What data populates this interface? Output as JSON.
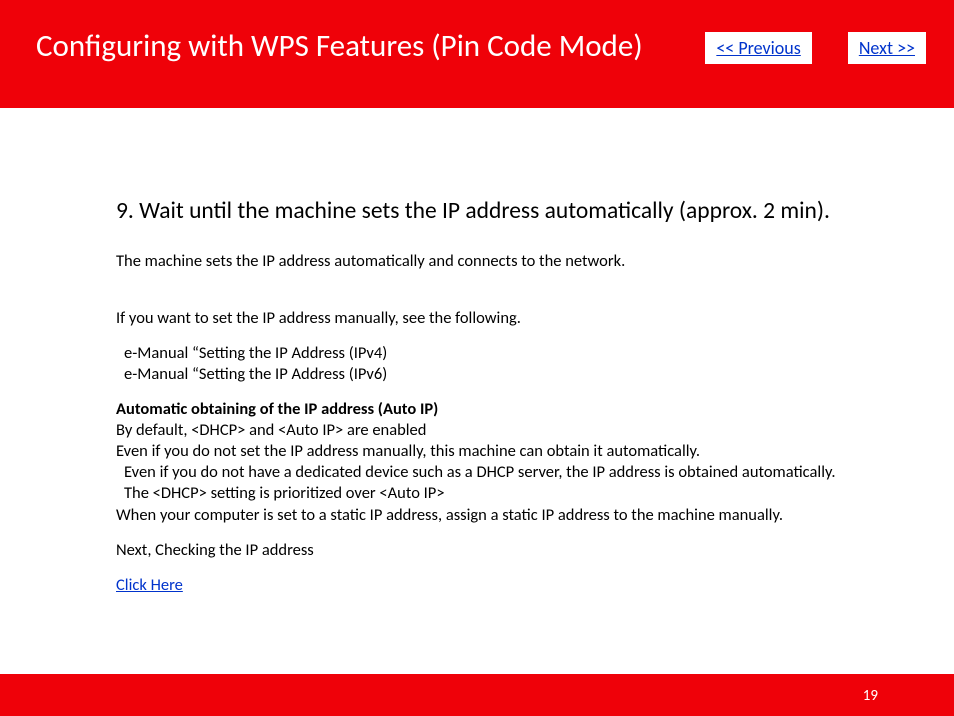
{
  "header": {
    "title": "Configuring with WPS Features (Pin Code Mode)",
    "previous_label": "<< Previous",
    "next_label": "Next >>"
  },
  "content": {
    "step_heading": "9. Wait until the machine sets the IP address automatically (approx. 2 min).",
    "intro": "The machine sets the IP address automatically and connects to the network.",
    "manual_note": "If you want to set the IP address manually, see the following.",
    "manual_ref_ipv4": "e-Manual “Setting the IP Address (IPv4)",
    "manual_ref_ipv6": "e-Manual “Setting the IP Address (IPv6)",
    "auto_ip_heading": "Automatic obtaining of the IP address (Auto IP)",
    "auto_ip_line1": "By default, <DHCP> and <Auto IP> are enabled",
    "auto_ip_line2": "Even if you do not set the IP address manually, this machine can obtain it automatically.",
    "auto_ip_line3": "Even if you do not have a dedicated device such as a DHCP server, the IP address is obtained automatically.",
    "auto_ip_line4": "The <DHCP> setting is prioritized over <Auto IP>",
    "auto_ip_line5": "When your computer is set to a static IP address, assign a static IP address to the machine manually.",
    "next_line": "Next, Checking the IP address",
    "link_label": "Click Here"
  },
  "footer": {
    "page_number": "19"
  },
  "colors": {
    "brand_red": "#ef0109",
    "link_blue": "#0033cc"
  }
}
